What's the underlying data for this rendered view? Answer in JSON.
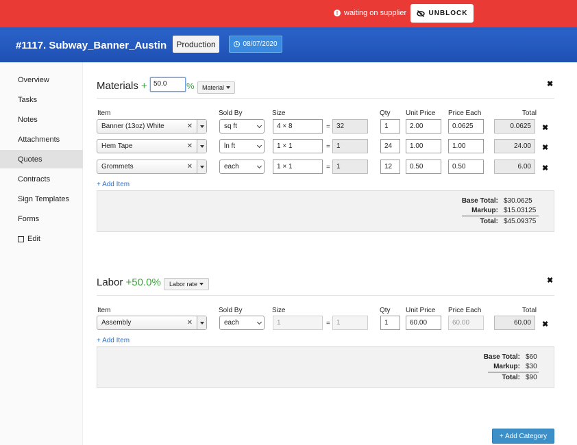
{
  "alert": {
    "status_text": "waiting on supplier",
    "unblock_label": "UNBLOCK"
  },
  "header": {
    "title": "#1117. Subway_Banner_Austin",
    "stage": "Production",
    "date": "08/07/2020"
  },
  "sidebar": {
    "items": [
      {
        "label": "Overview"
      },
      {
        "label": "Tasks"
      },
      {
        "label": "Notes"
      },
      {
        "label": "Attachments"
      },
      {
        "label": "Quotes",
        "active": true
      },
      {
        "label": "Contracts"
      },
      {
        "label": "Sign Templates"
      },
      {
        "label": "Forms"
      },
      {
        "label": "Edit"
      }
    ]
  },
  "columns": {
    "item": "Item",
    "sold_by": "Sold By",
    "size": "Size",
    "qty": "Qty",
    "unit_price": "Unit Price",
    "price_each": "Price Each",
    "total": "Total"
  },
  "materials": {
    "title": "Materials",
    "markup_prefix": "+",
    "markup_value": "50.0",
    "markup_suffix": "%",
    "type_dropdown": "Material",
    "rows": [
      {
        "item": "Banner (13oz) White",
        "sold_by": "sq ft",
        "size": "4 × 8",
        "area": "32",
        "qty": "1",
        "unit_price": "2.00",
        "price_each": "0.0625",
        "total": "0.0625"
      },
      {
        "item": "Hem Tape",
        "sold_by": "ln ft",
        "size": "1 × 1",
        "area": "1",
        "qty": "24",
        "unit_price": "1.00",
        "price_each": "1.00",
        "total": "24.00"
      },
      {
        "item": "Grommets",
        "sold_by": "each",
        "size": "1 × 1",
        "area": "1",
        "qty": "12",
        "unit_price": "0.50",
        "price_each": "0.50",
        "total": "6.00"
      }
    ],
    "add_item": "+ Add Item",
    "totals": {
      "base_label": "Base Total:",
      "base_value": "$30.0625",
      "markup_label": "Markup:",
      "markup_value": "$15.03125",
      "total_label": "Total:",
      "total_value": "$45.09375"
    }
  },
  "labor": {
    "title": "Labor",
    "markup": "+50.0%",
    "type_dropdown": "Labor rate",
    "rows": [
      {
        "item": "Assembly",
        "sold_by": "each",
        "size": "1",
        "area": "1",
        "qty": "1",
        "unit_price": "60.00",
        "price_each": "60.00",
        "total": "60.00"
      }
    ],
    "add_item": "+ Add Item",
    "totals": {
      "base_label": "Base Total:",
      "base_value": "$60",
      "markup_label": "Markup:",
      "markup_value": "$30",
      "total_label": "Total:",
      "total_value": "$90"
    }
  },
  "add_category": "+ Add Category",
  "colors": {
    "alert_red": "#ea3a36",
    "header_blue": "#2258bb",
    "markup_green": "#3aa63a",
    "link_blue": "#2a6ed0",
    "button_blue": "#3d8fc8"
  },
  "icons": [
    "info-icon",
    "eye-slash-icon",
    "clock-icon",
    "edit-icon",
    "close-icon",
    "dropdown-caret-icon"
  ]
}
